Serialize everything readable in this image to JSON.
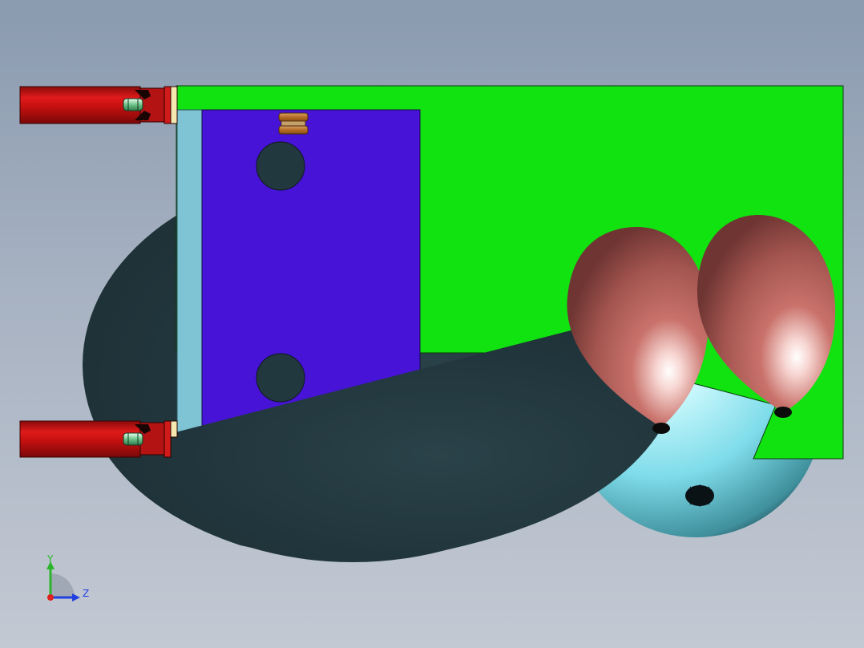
{
  "viewport": {
    "background_top": "#8a9aaf",
    "background_bottom": "#c3c9d3"
  },
  "model": {
    "plate_color": "#11e311",
    "block_color": "#4713d6",
    "side_strip_color": "#7ec4d4",
    "disc_color": "#22383f",
    "cylinder_color": "#c70f0f",
    "bulb_color": "#b55a55",
    "sphere_color": "#8ee8f2"
  },
  "triad": {
    "y_label": "Y",
    "z_label": "Z",
    "y_color": "#2ab52a",
    "z_color": "#2040e0",
    "x_color": "#e02020"
  }
}
